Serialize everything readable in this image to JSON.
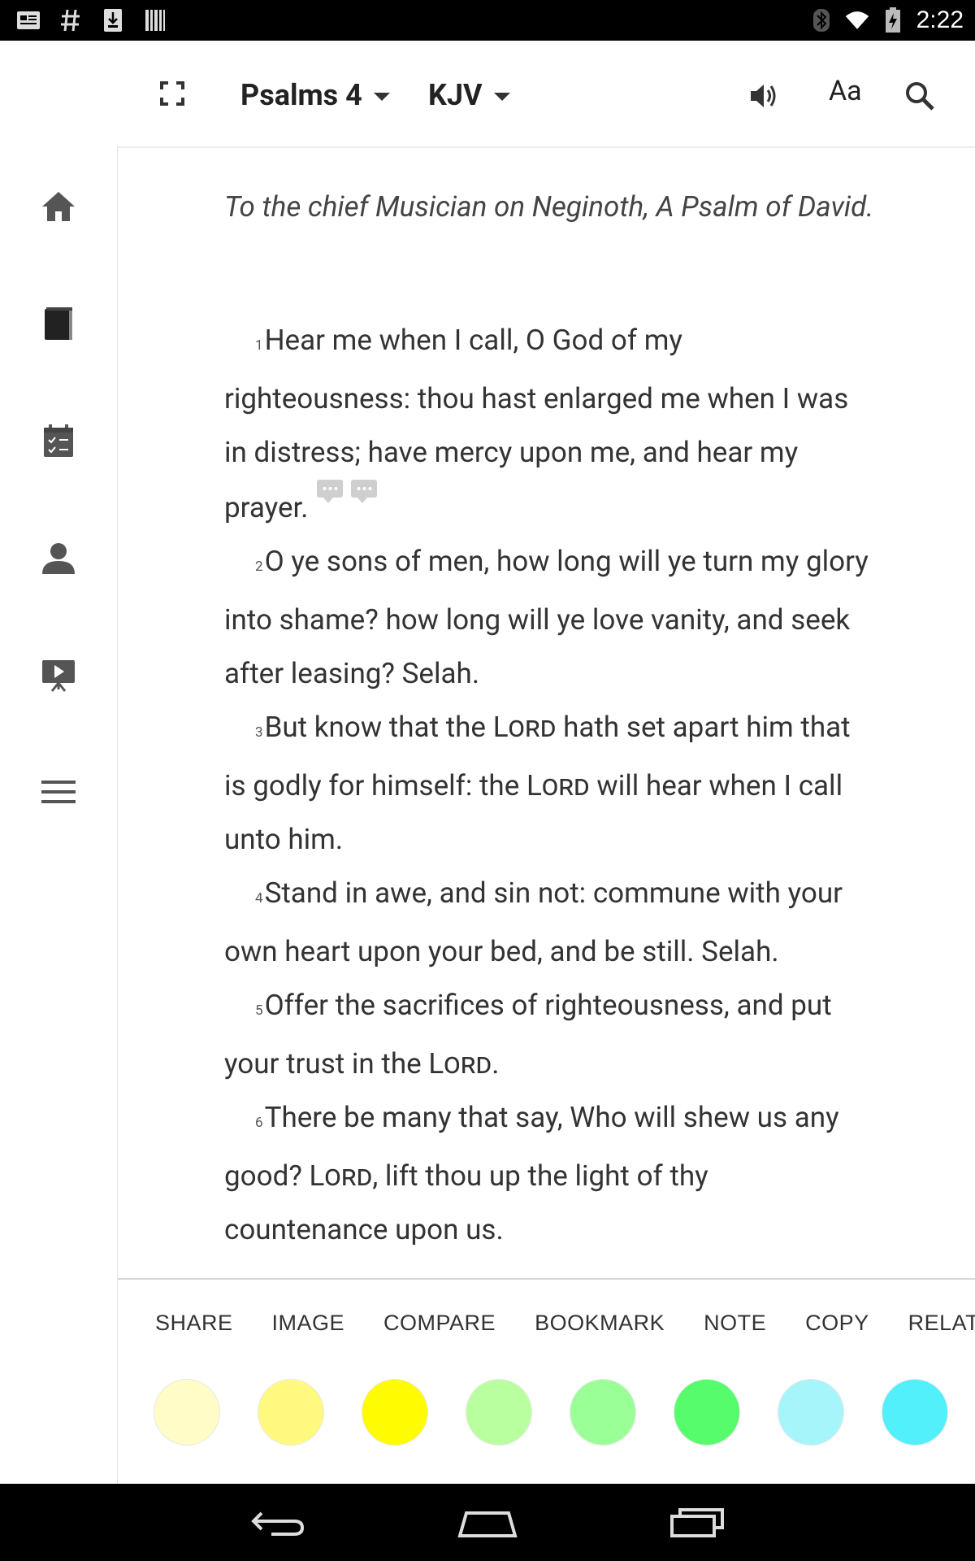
{
  "status_bar": {
    "time": "2:22",
    "left_icons": [
      "news-icon",
      "hash-icon",
      "download-icon",
      "barcode-icon"
    ],
    "right_icons": [
      "bluetooth-icon",
      "wifi-icon",
      "battery-charging-icon"
    ]
  },
  "toolbar": {
    "book_chapter": "Psalms 4",
    "version": "KJV",
    "font_label": "Aa"
  },
  "sidebar": {
    "items": [
      "home-icon",
      "bible-icon",
      "plans-icon",
      "profile-icon",
      "videos-icon",
      "menu-icon"
    ]
  },
  "reader": {
    "heading": "To the chief Musician on Neginoth, A Psalm of David.",
    "lord": "Lord",
    "verses": [
      {
        "num": "1",
        "text": "Hear me when I call, O God of my righteousness: thou hast enlarged me when I was in distress; have mercy upon me, and hear my prayer."
      },
      {
        "num": "2",
        "text": "O ye sons of men, how long will ye turn my glory into shame? how long will ye love vanity, and seek after leasing? Selah."
      },
      {
        "num": "3",
        "a": "But know that the ",
        "b": " hath set apart him that is godly for himself: the ",
        "c": " will hear when I call unto him."
      },
      {
        "num": "4",
        "text": "Stand in awe, and sin not: commune with your own heart upon your bed, and be still. Selah."
      },
      {
        "num": "5",
        "a": "Offer the sacrifices of righteousness, and put your trust in the ",
        "c": "."
      },
      {
        "num": "6",
        "a": "There be many that say, Who will shew us any good? ",
        "c": ", lift thou up the light of thy countenance upon us."
      }
    ]
  },
  "actions": [
    "SHARE",
    "IMAGE",
    "COMPARE",
    "BOOKMARK",
    "NOTE",
    "COPY",
    "RELATED"
  ],
  "highlight_colors": [
    "#fffcc7",
    "#fffa7f",
    "#fffb00",
    "#b9ff9f",
    "#9bff98",
    "#56fc6b",
    "#a6f5fb",
    "#52f0fb"
  ]
}
